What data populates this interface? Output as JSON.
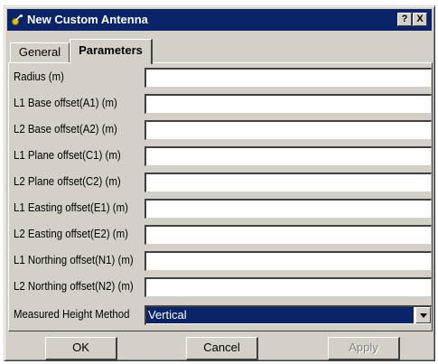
{
  "window": {
    "title": "New Custom Antenna",
    "help_glyph": "?",
    "close_glyph": "X"
  },
  "tabs": [
    {
      "label": "General",
      "active": false
    },
    {
      "label": "Parameters",
      "active": true
    }
  ],
  "fields": [
    {
      "label": "Radius (m)",
      "value": ""
    },
    {
      "label": "L1 Base offset(A1) (m)",
      "value": ""
    },
    {
      "label": "L2 Base offset(A2) (m)",
      "value": ""
    },
    {
      "label": "L1 Plane offset(C1) (m)",
      "value": ""
    },
    {
      "label": "L2 Plane offset(C2) (m)",
      "value": ""
    },
    {
      "label": "L1 Easting offset(E1) (m)",
      "value": ""
    },
    {
      "label": "L2 Easting offset(E2) (m)",
      "value": ""
    },
    {
      "label": "L1 Northing offset(N1) (m)",
      "value": ""
    },
    {
      "label": "L2 Northing offset(N2) (m)",
      "value": ""
    }
  ],
  "measured_height": {
    "label": "Measured Height Method",
    "selected": "Vertical"
  },
  "buttons": {
    "ok": "OK",
    "cancel": "Cancel",
    "apply": "Apply"
  },
  "colors": {
    "titlebar": "#0a246a",
    "face": "#d4d0c8",
    "selection": "#0a246a"
  }
}
